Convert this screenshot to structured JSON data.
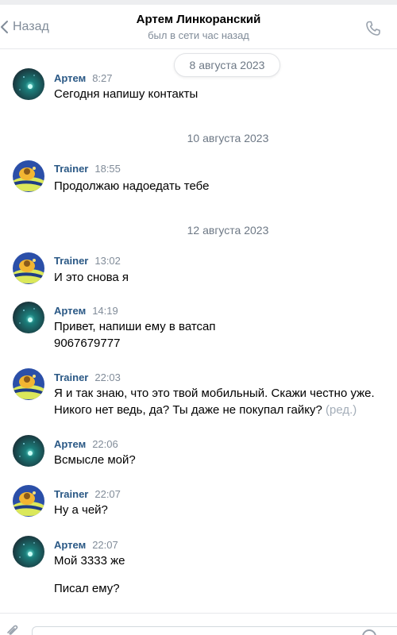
{
  "header": {
    "back_label": "Назад",
    "title": "Артем Линкоранский",
    "status": "был в сети час назад"
  },
  "floating_date": "8 августа 2023",
  "date_separators": [
    "10 августа 2023",
    "12 августа 2023"
  ],
  "messages": [
    {
      "author": "Артем",
      "time": "8:27",
      "lines": [
        "Сегодня напишу контакты"
      ]
    },
    {
      "author": "Trainer",
      "time": "18:55",
      "lines": [
        "Продолжаю надоедать тебе"
      ]
    },
    {
      "author": "Trainer",
      "time": "13:02",
      "lines": [
        "И это снова я"
      ]
    },
    {
      "author": "Артем",
      "time": "14:19",
      "lines": [
        "Привет, напиши ему в ватсап",
        "9067679777"
      ]
    },
    {
      "author": "Trainer",
      "time": "22:03",
      "lines": [
        "Я и так знаю, что это твой мобильный. Скажи честно уже.",
        "Никого нет ведь, да? Ты даже не покупал гайку?"
      ],
      "edited_label": "(ред.)"
    },
    {
      "author": "Артем",
      "time": "22:06",
      "lines": [
        "Всмысле мой?"
      ]
    },
    {
      "author": "Trainer",
      "time": "22:07",
      "lines": [
        "Ну а чей?"
      ]
    },
    {
      "author": "Артем",
      "time": "22:07",
      "lines": [
        "Мой 3333 же",
        "Писал ему?"
      ]
    }
  ],
  "colors": {
    "author": "#2a5885",
    "muted": "#818c99",
    "edited": "#a3adb8"
  },
  "icons": {
    "back": "chevron-left-icon",
    "call": "phone-icon",
    "attach": "paperclip-icon",
    "emoji": "smile-icon"
  }
}
